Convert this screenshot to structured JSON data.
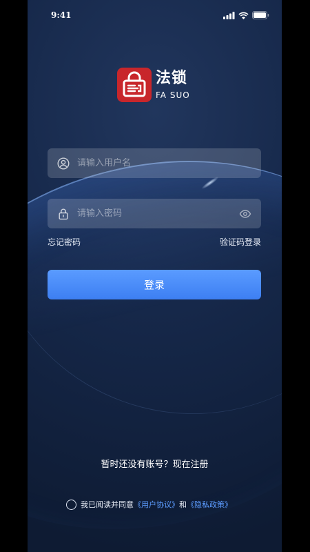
{
  "status": {
    "time": "9:41"
  },
  "logo": {
    "cn": "法锁",
    "en": "FA SUO",
    "brand_color": "#c8262b"
  },
  "form": {
    "username_placeholder": "请输入用户名",
    "password_placeholder": "请输入密码",
    "forgot_password": "忘记密码",
    "code_login": "验证码登录",
    "login_button": "登录"
  },
  "register": {
    "text": "暂时还没有账号？现在注册"
  },
  "agreement": {
    "prefix": "我已阅读并同意",
    "user_agreement": "《用户协议》",
    "conj": "和",
    "privacy_policy": "《隐私政策》",
    "checked": false
  },
  "colors": {
    "accent": "#4287f5",
    "link": "#5c9cff",
    "background": "#16284a"
  }
}
